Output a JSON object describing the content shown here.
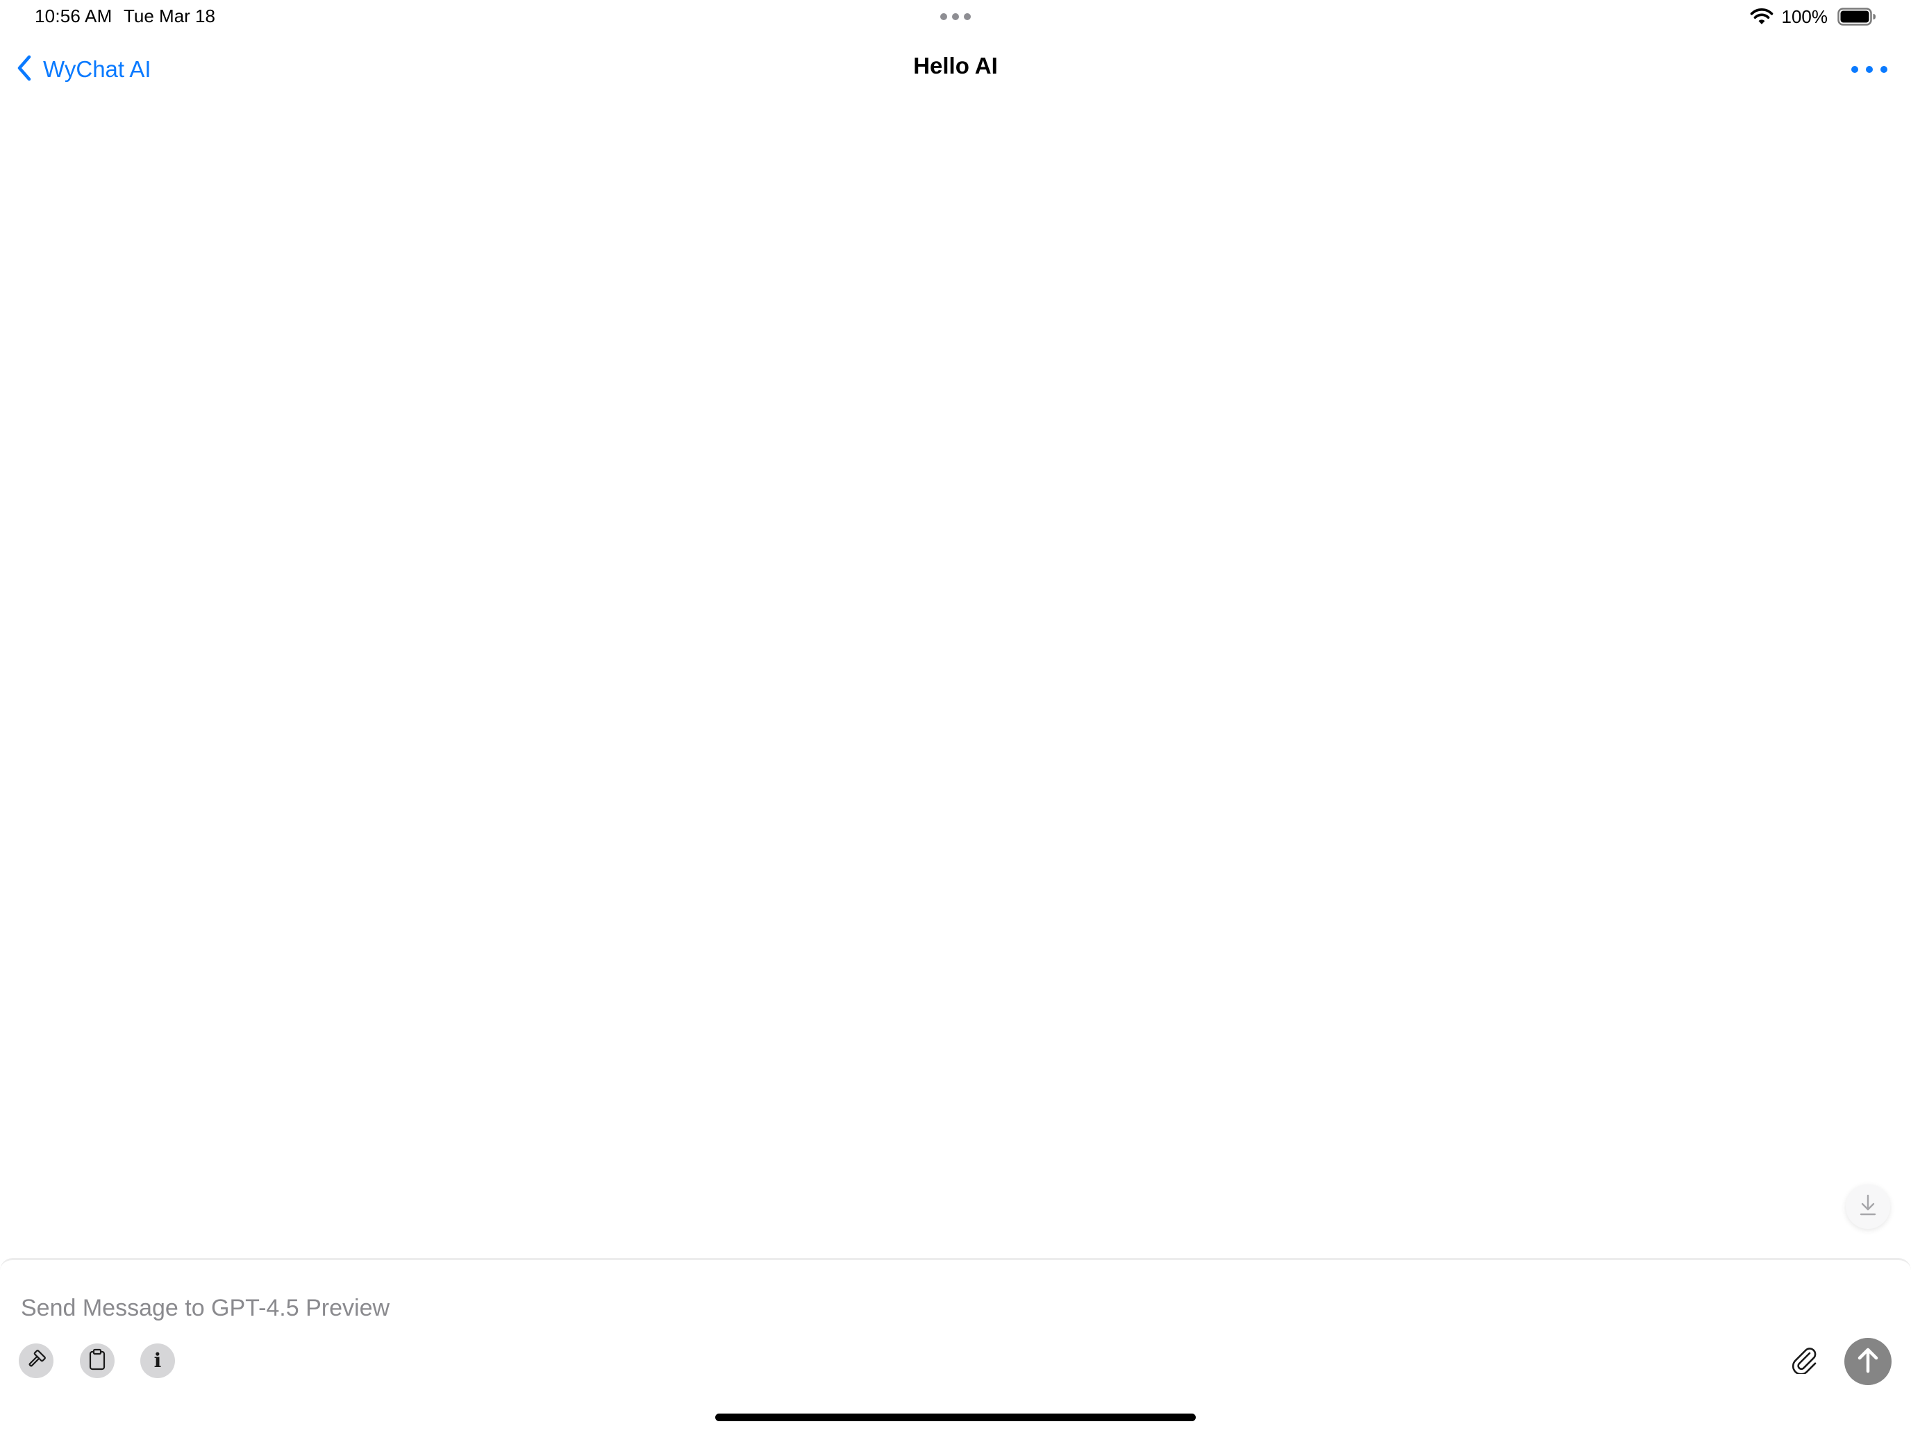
{
  "status_bar": {
    "time": "10:56 AM",
    "date": "Tue Mar 18",
    "battery_percent": "100%",
    "icons": [
      "wifi-icon",
      "battery-icon"
    ]
  },
  "nav": {
    "back_label": "WyChat AI",
    "title": "Hello AI",
    "accent_color": "#0a7aff"
  },
  "composer": {
    "placeholder": "Send Message to GPT-4.5 Preview",
    "value": "",
    "tools": [
      "hammer-icon",
      "clipboard-icon",
      "info-icon"
    ],
    "info_glyph": "i",
    "send_button_color": "#858585"
  }
}
